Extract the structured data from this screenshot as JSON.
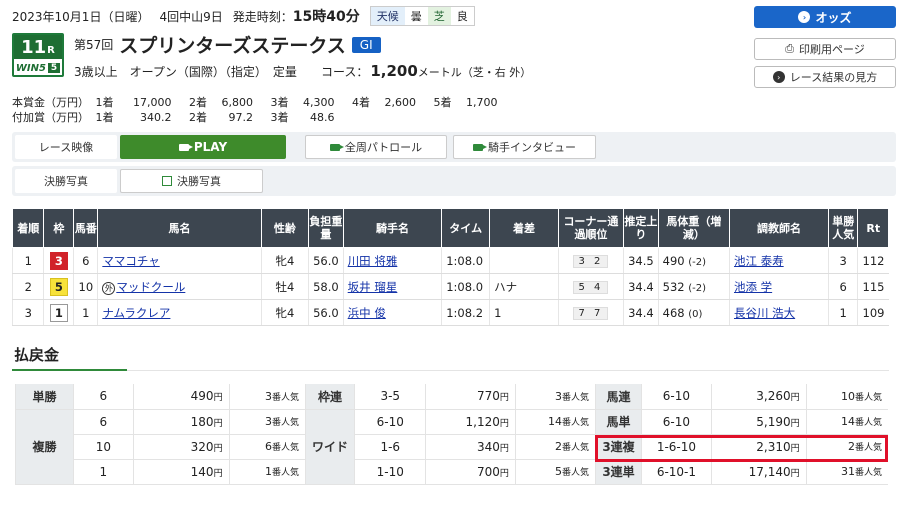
{
  "header": {
    "date": "2023年10月1日（日曜）",
    "meeting": "4回中山9日",
    "start_label": "発走時刻：",
    "start_time": "15時40分",
    "weather_label": "天候",
    "weather": "曇",
    "track_label": "芝",
    "track": "良"
  },
  "race": {
    "number": "11",
    "number_suffix": "R",
    "win5": "WIN5",
    "win5_num": "5",
    "ordinal": "第57回",
    "name": "スプリンターズステークス",
    "grade": "GI",
    "conditions": "3歳以上　オープン（国際）（指定）　定量",
    "course_label": "コース：",
    "distance": "1,200",
    "distance_unit": "メートル（芝・右 外）"
  },
  "prize": {
    "main_label": "本賞金（万円）",
    "main": [
      [
        "1着",
        "17,000"
      ],
      [
        "2着",
        "6,800"
      ],
      [
        "3着",
        "4,300"
      ],
      [
        "4着",
        "2,600"
      ],
      [
        "5着",
        "1,700"
      ]
    ],
    "add_label": "付加賞（万円）",
    "add": [
      [
        "1着",
        "340.2"
      ],
      [
        "2着",
        "97.2"
      ],
      [
        "3着",
        "48.6"
      ]
    ]
  },
  "side_buttons": {
    "odds": "オッズ",
    "print": "印刷用ページ",
    "guide": "レース結果の見方"
  },
  "media": {
    "video_label": "レース映像",
    "play": "PLAY",
    "patrol": "全周パトロール",
    "interview": "騎手インタビュー",
    "photo_label": "決勝写真",
    "photo_btn": "決勝写真"
  },
  "results": {
    "headers": [
      "着順",
      "枠",
      "馬番",
      "馬名",
      "性齢",
      "負担重量",
      "騎手名",
      "タイム",
      "着差",
      "コーナー通過順位",
      "推定上り",
      "馬体重（増減）",
      "調教師名",
      "単勝人気",
      "Rt"
    ],
    "rows": [
      {
        "rank": "1",
        "waku": "3",
        "umaban": "6",
        "mark": "",
        "horse": "ママコチャ",
        "sexage": "牝4",
        "weight": "56.0",
        "jockey": "川田 将雅",
        "time": "1:08.0",
        "margin": "",
        "corner": "3 2",
        "agari": "34.5",
        "bw": "490",
        "bwd": "(-2)",
        "trainer": "池江 泰寿",
        "pop": "3",
        "rt": "112"
      },
      {
        "rank": "2",
        "waku": "5",
        "umaban": "10",
        "mark": "外",
        "horse": "マッドクール",
        "sexage": "牡4",
        "weight": "58.0",
        "jockey": "坂井 瑠星",
        "time": "1:08.0",
        "margin": "ハナ",
        "corner": "5 4",
        "agari": "34.4",
        "bw": "532",
        "bwd": "(-2)",
        "trainer": "池添 学",
        "pop": "6",
        "rt": "115"
      },
      {
        "rank": "3",
        "waku": "1",
        "umaban": "1",
        "mark": "",
        "horse": "ナムラクレア",
        "sexage": "牝4",
        "weight": "56.0",
        "jockey": "浜中 俊",
        "time": "1:08.2",
        "margin": "1",
        "corner": "7 7",
        "agari": "34.4",
        "bw": "468",
        "bwd": "(0)",
        "trainer": "長谷川 浩大",
        "pop": "1",
        "rt": "109"
      }
    ]
  },
  "payout": {
    "title": "払戻金",
    "yen": "円",
    "ninki": "番人気",
    "tansho": "単勝",
    "fukusho": "複勝",
    "wakuren": "枠連",
    "wide": "ワイド",
    "umaren": "馬連",
    "umatan": "馬単",
    "sanrenpuku": "3連複",
    "sanrentan": "3連単",
    "tansho_row": [
      "6",
      "490",
      "3"
    ],
    "fukusho_rows": [
      [
        "6",
        "180",
        "3"
      ],
      [
        "10",
        "320",
        "6"
      ],
      [
        "1",
        "140",
        "1"
      ]
    ],
    "wakuren_row": [
      "3-5",
      "770",
      "3"
    ],
    "wide_rows": [
      [
        "6-10",
        "1,120",
        "14"
      ],
      [
        "1-6",
        "340",
        "2"
      ],
      [
        "1-10",
        "700",
        "5"
      ]
    ],
    "umaren_row": [
      "6-10",
      "3,260",
      "10"
    ],
    "umatan_row": [
      "6-10",
      "5,190",
      "14"
    ],
    "sanrenpuku_row": [
      "1-6-10",
      "2,310",
      "2"
    ],
    "sanrentan_row": [
      "6-10-1",
      "17,140",
      "31"
    ]
  },
  "colors": {
    "green": "#1e6e33",
    "blue": "#1a66c9",
    "header_bg": "#3d4650",
    "highlight": "#e0102a"
  }
}
